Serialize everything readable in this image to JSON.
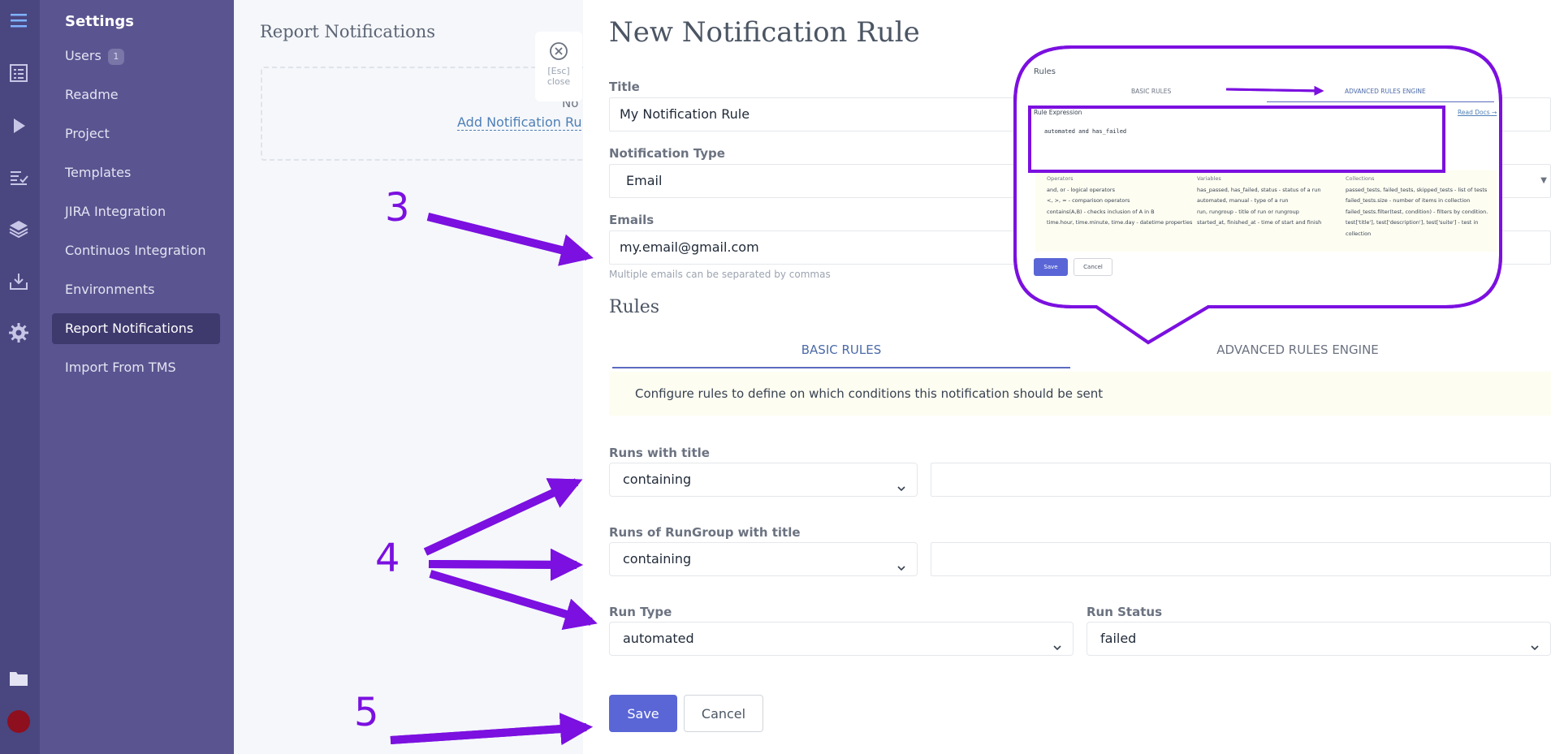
{
  "rail": {
    "icons": [
      "menu-icon",
      "checklist-icon",
      "play-icon",
      "test-runs-icon",
      "layers-icon",
      "download-icon",
      "gear-icon",
      "folder-icon",
      "avatar"
    ]
  },
  "nav": {
    "title": "Settings",
    "items": [
      {
        "label": "Users",
        "badge": "1"
      },
      {
        "label": "Readme"
      },
      {
        "label": "Project"
      },
      {
        "label": "Templates"
      },
      {
        "label": "JIRA Integration"
      },
      {
        "label": "Continuos Integration"
      },
      {
        "label": "Environments"
      },
      {
        "label": "Report Notifications",
        "active": true
      },
      {
        "label": "Import From TMS"
      }
    ]
  },
  "background": {
    "title": "Report Notifications",
    "empty_text": "No",
    "add_link": "Add Notification Rule",
    "esc_line1": "[Esc]",
    "esc_line2": "close"
  },
  "form": {
    "heading": "New Notification Rule",
    "title_label": "Title",
    "title_value": "My Notification Rule",
    "type_label": "Notification Type",
    "type_value": "Email",
    "emails_label": "Emails",
    "emails_value": "my.email@gmail.com",
    "emails_hint": "Multiple emails can be separated by commas",
    "rules_heading": "Rules",
    "tab_basic": "BASIC RULES",
    "tab_advanced": "ADVANCED RULES ENGINE",
    "info": "Configure rules to define on which conditions this notification should be sent",
    "runs_title_label": "Runs with title",
    "runs_title_op": "containing",
    "runs_title_value": "",
    "rungroup_label": "Runs of RunGroup with title",
    "rungroup_op": "containing",
    "rungroup_value": "",
    "run_type_label": "Run Type",
    "run_type_value": "automated",
    "run_status_label": "Run Status",
    "run_status_value": "failed",
    "save": "Save",
    "cancel": "Cancel"
  },
  "annotations": {
    "n3": "3",
    "n4_left": "4",
    "n4_top": "4",
    "n5": "5",
    "color": "#7b10e0"
  },
  "callout": {
    "rules_title": "Rules",
    "tab_basic": "BASIC RULES",
    "tab_advanced": "ADVANCED RULES ENGINE",
    "expression_label": "Rule Expression",
    "read_docs": "Read Docs →",
    "expression_value": "automated and has_failed",
    "columns": [
      {
        "header": "Operators",
        "rows": [
          "and, or - logical operators",
          "<, >, = - comparison operators",
          "contains(A,B) - checks inclusion of A in B",
          "time.hour, time.minute, time.day - datetime properties"
        ]
      },
      {
        "header": "Variables",
        "rows": [
          "has_passed, has_failed, status - status of a run",
          "automated, manual - type of a run",
          "run, rungroup - title of run or rungroup",
          "started_at, finished_at - time of start and finish"
        ]
      },
      {
        "header": "Collections",
        "rows": [
          "passed_tests, failed_tests, skipped_tests - list of tests",
          "failed_tests.size - number of items in collection",
          "failed_tests.filter(test, condition) - filters by condition.",
          "test['title'], test['description'], test['suite'] - test in",
          "collection"
        ]
      }
    ],
    "save": "Save",
    "cancel": "Cancel"
  }
}
